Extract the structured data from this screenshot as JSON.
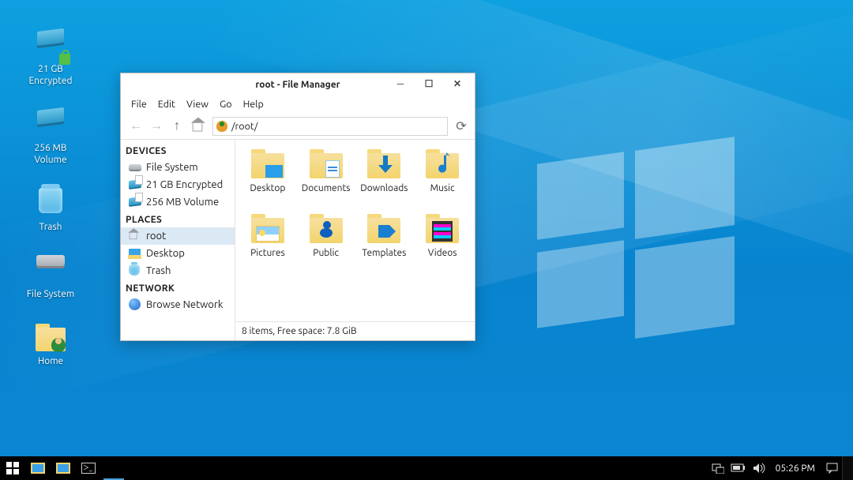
{
  "desktop": {
    "icons": [
      {
        "label": "21 GB\nEncrypted"
      },
      {
        "label": "256 MB\nVolume"
      },
      {
        "label": "Trash"
      },
      {
        "label": "File System"
      },
      {
        "label": "Home"
      }
    ]
  },
  "fm": {
    "title": "root - File Manager",
    "menu": [
      "File",
      "Edit",
      "View",
      "Go",
      "Help"
    ],
    "path": "/root/",
    "sidebar": {
      "sections": [
        {
          "head": "DEVICES",
          "items": [
            "File System",
            "21 GB Encrypted",
            "256 MB Volume"
          ]
        },
        {
          "head": "PLACES",
          "items": [
            "root",
            "Desktop",
            "Trash"
          ]
        },
        {
          "head": "NETWORK",
          "items": [
            "Browse Network"
          ]
        }
      ]
    },
    "files": [
      "Desktop",
      "Documents",
      "Downloads",
      "Music",
      "Pictures",
      "Public",
      "Templates",
      "Videos"
    ],
    "status": "8 items, Free space: 7.8 GiB"
  },
  "taskbar": {
    "time": "05:26 PM"
  }
}
